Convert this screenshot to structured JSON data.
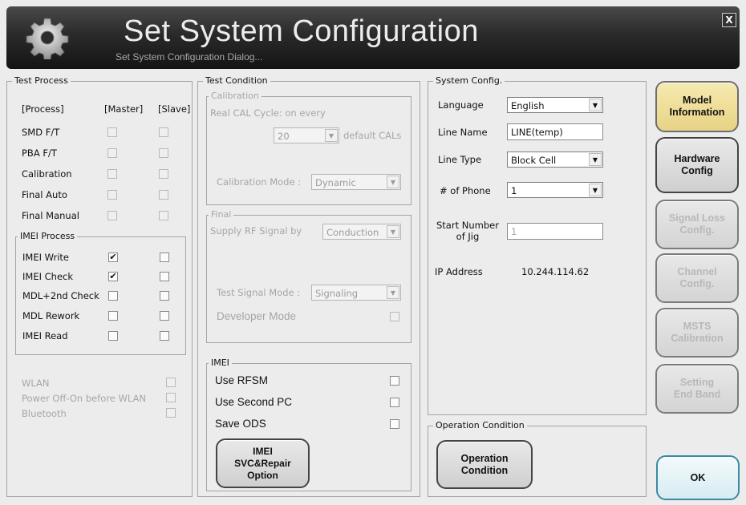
{
  "header": {
    "title": "Set System Configuration",
    "subtitle": "Set System Configuration Dialog...",
    "close_label": "X"
  },
  "test_process": {
    "legend": "Test Process",
    "col_process": "[Process]",
    "col_master": "[Master]",
    "col_slave": "[Slave]",
    "rows": [
      {
        "label": "SMD F/T",
        "master": "",
        "slave": ""
      },
      {
        "label": "PBA F/T",
        "master": "",
        "slave": ""
      },
      {
        "label": "Calibration",
        "master": "",
        "slave": ""
      },
      {
        "label": "Final Auto",
        "master": "",
        "slave": ""
      },
      {
        "label": "Final Manual",
        "master": "",
        "slave": ""
      }
    ],
    "imei_process": {
      "legend": "IMEI Process",
      "rows": [
        {
          "label": "IMEI Write",
          "master": "✔",
          "slave": ""
        },
        {
          "label": "IMEI Check",
          "master": "✔",
          "slave": ""
        },
        {
          "label": "MDL+2nd Check",
          "master": "",
          "slave": ""
        },
        {
          "label": "MDL Rework",
          "master": "",
          "slave": ""
        },
        {
          "label": "IMEI Read",
          "master": "",
          "slave": ""
        }
      ]
    },
    "extras": [
      {
        "label": "WLAN"
      },
      {
        "label": "Power Off-On before WLAN"
      },
      {
        "label": "Bluetooth"
      }
    ]
  },
  "test_condition": {
    "legend": "Test Condition",
    "calibration": {
      "legend": "Calibration",
      "cycle_label": "Real CAL Cycle: on every",
      "cycle_value": "20",
      "default_label": "default CALs",
      "mode_label": "Calibration Mode :",
      "mode_value": "Dynamic"
    },
    "final": {
      "legend": "Final",
      "rf_label": "Supply RF Signal by",
      "rf_value": "Conduction",
      "signal_label": "Test Signal Mode :",
      "signal_value": "Signaling",
      "developer_label": "Developer Mode"
    },
    "imei": {
      "legend": "IMEI",
      "options": [
        {
          "label": "Use RFSM"
        },
        {
          "label": "Use Second PC"
        },
        {
          "label": "Save ODS"
        }
      ],
      "button_label": "IMEI\nSVC&Repair\nOption"
    }
  },
  "system_config": {
    "legend": "System Config.",
    "language_label": "Language",
    "language_value": "English",
    "line_name_label": "Line Name",
    "line_name_value": "LINE(temp)",
    "line_type_label": "Line Type",
    "line_type_value": "Block Cell",
    "phone_label": "# of Phone",
    "phone_value": "1",
    "start_jig_label": "Start Number\nof Jig",
    "start_jig_value": "1",
    "ip_label": "IP Address",
    "ip_value": "10.244.114.62"
  },
  "operation_condition": {
    "legend": "Operation Condition",
    "button_label": "Operation\nCondition"
  },
  "side_buttons": [
    {
      "label": "Model\nInformation",
      "state": "active"
    },
    {
      "label": "Hardware\nConfig",
      "state": "enabled"
    },
    {
      "label": "Signal Loss\nConfig.",
      "state": "disabled"
    },
    {
      "label": "Channel\nConfig.",
      "state": "disabled"
    },
    {
      "label": "MSTS\nCalibration",
      "state": "disabled"
    },
    {
      "label": "Setting\nEnd Band",
      "state": "disabled"
    }
  ],
  "ok_label": "OK"
}
